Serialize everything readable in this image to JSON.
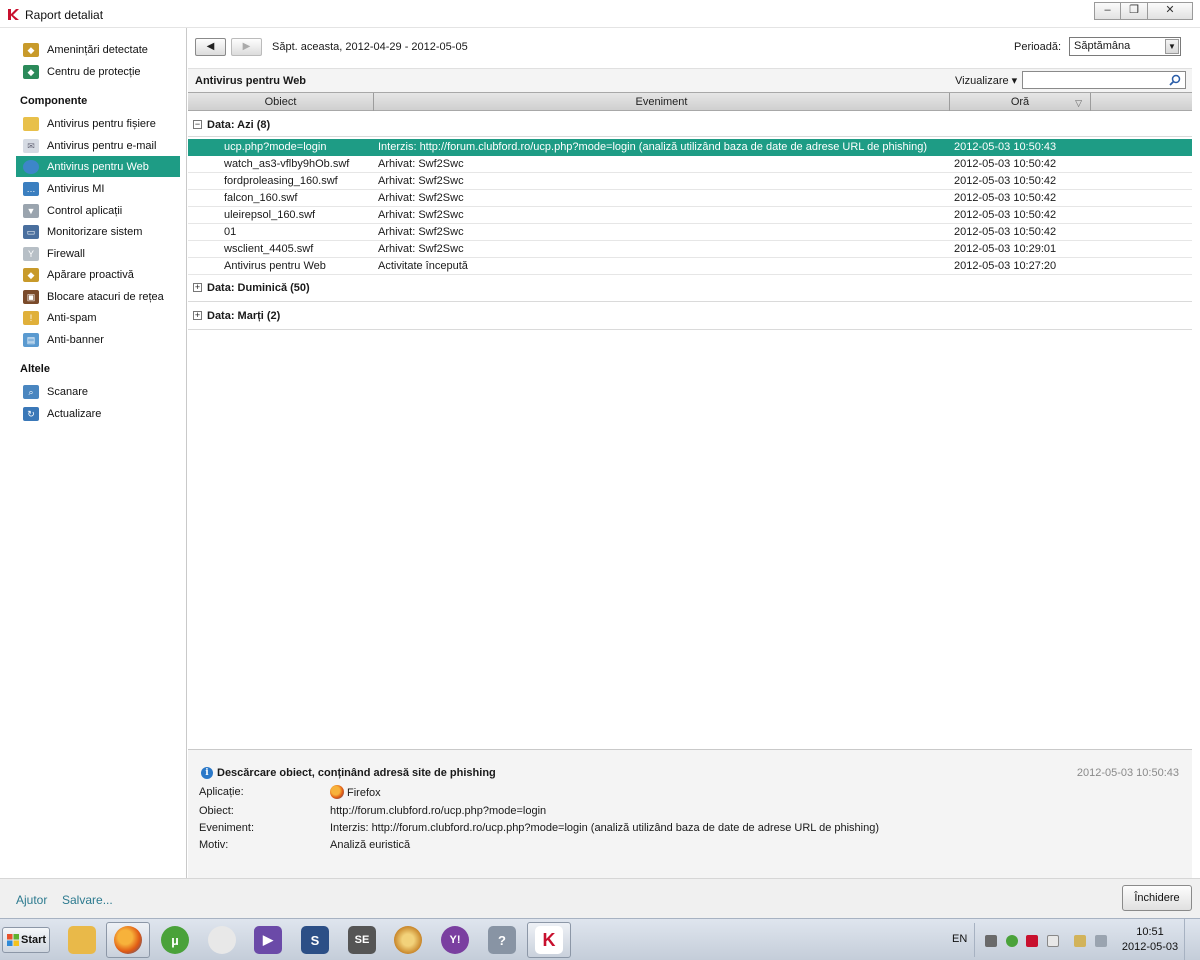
{
  "window": {
    "title": "Raport detaliat"
  },
  "sidebar": {
    "items_top": [
      {
        "label": "Amenințări detectate",
        "icon": "shield-icon"
      },
      {
        "label": "Centru de protecție",
        "icon": "shield-icon"
      }
    ],
    "section_components": "Componente",
    "components": [
      {
        "label": "Antivirus pentru fișiere",
        "icon": "folder-icon"
      },
      {
        "label": "Antivirus pentru e-mail",
        "icon": "mail-icon"
      },
      {
        "label": "Antivirus pentru Web",
        "icon": "globe-icon",
        "active": true
      },
      {
        "label": "Antivirus MI",
        "icon": "chat-icon"
      },
      {
        "label": "Control aplicații",
        "icon": "filter-icon"
      },
      {
        "label": "Monitorizare sistem",
        "icon": "monitor-icon"
      },
      {
        "label": "Firewall",
        "icon": "firewall-icon"
      },
      {
        "label": "Apărare proactivă",
        "icon": "shield-icon"
      },
      {
        "label": "Blocare atacuri de rețea",
        "icon": "network-icon"
      },
      {
        "label": "Anti-spam",
        "icon": "spam-icon"
      },
      {
        "label": "Anti-banner",
        "icon": "banner-icon"
      }
    ],
    "section_other": "Altele",
    "other": [
      {
        "label": "Scanare",
        "icon": "scan-icon"
      },
      {
        "label": "Actualizare",
        "icon": "update-icon"
      }
    ]
  },
  "toolbar": {
    "back_label": "◀",
    "forward_label": "▶",
    "period_range": "Săpt. aceasta, 2012-04-29 - 2012-05-05",
    "period_label": "Perioadă:",
    "period_value": "Săptămâna"
  },
  "section": {
    "title": "Antivirus pentru Web",
    "view_label": "Vizualizare ▾",
    "search_placeholder": ""
  },
  "table": {
    "columns": [
      "Obiect",
      "Eveniment",
      "Oră"
    ],
    "groups": [
      {
        "label": "Data: Azi (8)",
        "expanded": true,
        "toggle": "−",
        "rows": [
          {
            "object": "ucp.php?mode=login",
            "event": "Interzis: http://forum.clubford.ro/ucp.php?mode=login (analiză utilizând baza de date de adrese URL de phishing)",
            "time": "2012-05-03 10:50:43",
            "selected": true
          },
          {
            "object": "watch_as3-vflby9hOb.swf",
            "event": "Arhivat: Swf2Swc",
            "time": "2012-05-03 10:50:42"
          },
          {
            "object": "fordproleasing_160.swf",
            "event": "Arhivat: Swf2Swc",
            "time": "2012-05-03 10:50:42"
          },
          {
            "object": "falcon_160.swf",
            "event": "Arhivat: Swf2Swc",
            "time": "2012-05-03 10:50:42"
          },
          {
            "object": "uleirepsol_160.swf",
            "event": "Arhivat: Swf2Swc",
            "time": "2012-05-03 10:50:42"
          },
          {
            "object": "01",
            "event": "Arhivat: Swf2Swc",
            "time": "2012-05-03 10:50:42"
          },
          {
            "object": "wsclient_4405.swf",
            "event": "Arhivat: Swf2Swc",
            "time": "2012-05-03 10:29:01"
          },
          {
            "object": "Antivirus pentru Web",
            "event": "Activitate începută",
            "time": "2012-05-03 10:27:20"
          }
        ]
      },
      {
        "label": "Data: Duminică (50)",
        "expanded": false,
        "toggle": "+",
        "rows": []
      },
      {
        "label": "Data: Marți (2)",
        "expanded": false,
        "toggle": "+",
        "rows": []
      }
    ]
  },
  "details": {
    "title": "Descărcare obiect, conținând adresă site de phishing",
    "time": "2012-05-03 10:50:43",
    "fields": [
      {
        "label": "Aplicație:",
        "value": "Firefox"
      },
      {
        "label": "Obiect:",
        "value": "http://forum.clubford.ro/ucp.php?mode=login"
      },
      {
        "label": "Eveniment:",
        "value": "Interzis: http://forum.clubford.ro/ucp.php?mode=login (analiză utilizând baza de date de adrese URL de phishing)"
      },
      {
        "label": "Motiv:",
        "value": "Analiză euristică"
      }
    ]
  },
  "footer": {
    "help_label": "Ajutor",
    "save_label": "Salvare...",
    "close_label": "Închidere"
  },
  "taskbar": {
    "start_label": "Start",
    "language": "EN",
    "clock_time": "10:51",
    "clock_date": "2012-05-03",
    "apps": [
      {
        "name": "explorer-icon",
        "color": "#e9b949",
        "glyph": ""
      },
      {
        "name": "firefox-icon",
        "color": "#d85c1c",
        "glyph": ""
      },
      {
        "name": "utorrent-icon",
        "color": "#4aa23a",
        "glyph": "µ"
      },
      {
        "name": "alien-icon",
        "color": "#e8e8e8",
        "glyph": ""
      },
      {
        "name": "media-player-icon",
        "color": "#6b4aa8",
        "glyph": "▶"
      },
      {
        "name": "subtitle-icon",
        "color": "#2c4f86",
        "glyph": "S"
      },
      {
        "name": "se-icon",
        "color": "#555555",
        "glyph": "SE"
      },
      {
        "name": "burn-icon",
        "color": "#c8862a",
        "glyph": ""
      },
      {
        "name": "yahoo-messenger-icon",
        "color": "#7a3fa0",
        "glyph": "Y!"
      },
      {
        "name": "tools-icon",
        "color": "#8894a4",
        "glyph": "?"
      },
      {
        "name": "kaspersky-icon",
        "color": "#ffffff",
        "glyph": "K",
        "active": true
      }
    ]
  },
  "colors": {
    "accent": "#1e9c85",
    "link": "#2c7a8f"
  }
}
